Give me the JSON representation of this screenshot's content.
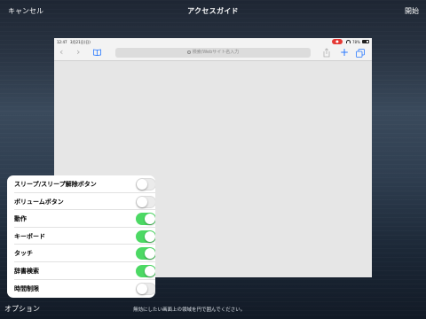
{
  "topbar": {
    "cancel_label": "キャンセル",
    "title": "アクセスガイド",
    "start_label": "開始"
  },
  "device": {
    "status": {
      "time": "12:47",
      "date": "3月21日(日)",
      "battery": "78%"
    },
    "url_placeholder": "検索/Webサイト名入力"
  },
  "options": {
    "items": [
      {
        "label": "スリープ/スリープ解除ボタン",
        "on": false
      },
      {
        "label": "ボリュームボタン",
        "on": false
      },
      {
        "label": "動作",
        "on": true
      },
      {
        "label": "キーボード",
        "on": true
      },
      {
        "label": "タッチ",
        "on": true
      },
      {
        "label": "辞書検索",
        "on": true
      },
      {
        "label": "時間制限",
        "on": false
      }
    ]
  },
  "bottombar": {
    "options_label": "オプション",
    "hint": "無効にしたい画面上の領域を円で囲んでください。"
  },
  "colors": {
    "switch_on": "#4cd964",
    "accent_blue": "#2979ff",
    "record_red": "#e53935"
  }
}
